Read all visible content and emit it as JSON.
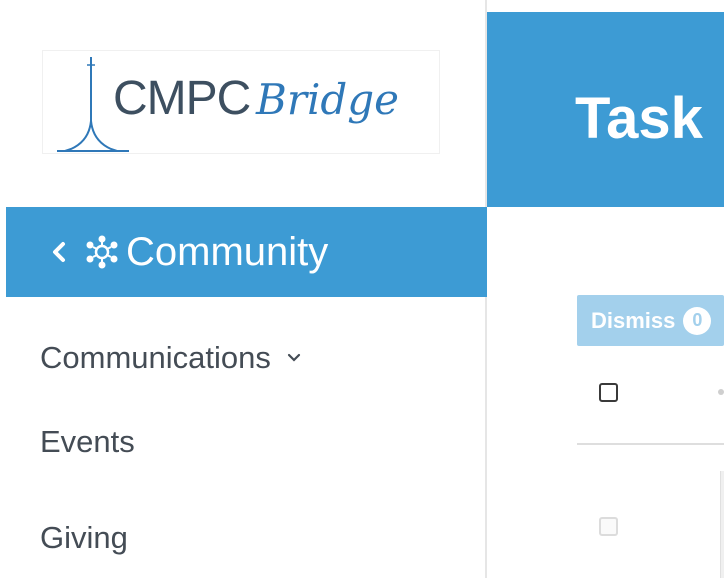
{
  "logo": {
    "primary_text": "CMPC",
    "secondary_text": "Bridge",
    "icon": "antenna-tower-icon"
  },
  "sidebar": {
    "section": {
      "label": "Community",
      "back_icon": "chevron-left-icon",
      "icon": "community-network-icon"
    },
    "items": [
      {
        "label": "Communications",
        "icon": "chevron-down-icon"
      },
      {
        "label": "Events"
      },
      {
        "label": "Giving"
      }
    ]
  },
  "header": {
    "title": "Task"
  },
  "toolbar": {
    "dismiss_label": "Dismiss",
    "dismiss_count": "0"
  },
  "colors": {
    "accent": "#3d9bd4",
    "dismiss_disabled": "#a3d0ec",
    "nav_text": "#444c55"
  }
}
